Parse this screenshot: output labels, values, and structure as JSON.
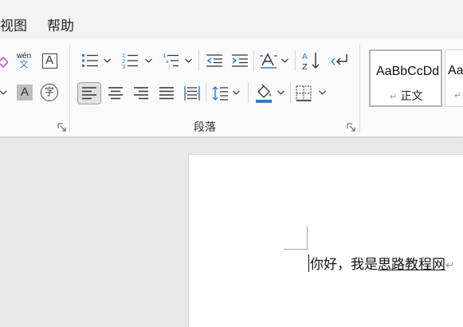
{
  "menu": {
    "items": [
      {
        "label": "视图"
      },
      {
        "label": "帮助"
      }
    ]
  },
  "ribbon": {
    "font_group": {
      "phonetic_glyph": "wén",
      "phonetic_char": "文",
      "char_border_glyph": "A",
      "shading_glyph": "A",
      "enclose_glyph": "字"
    },
    "paragraph_group": {
      "label": "段落"
    },
    "styles_group": {
      "items": [
        {
          "sample": "AaBbCcDd",
          "name": "正文",
          "selected": true
        },
        {
          "sample": "AaBl",
          "name": "",
          "selected": false
        }
      ]
    }
  },
  "document": {
    "text_plain": "你好，我是",
    "text_underlined": "思路教程网",
    "paragraph_mark": "↵"
  },
  "colors": {
    "accent": "#2b7cd3",
    "active_button": "#e1e1e1",
    "page": "#ffffff",
    "canvas": "#e9e9e9"
  }
}
